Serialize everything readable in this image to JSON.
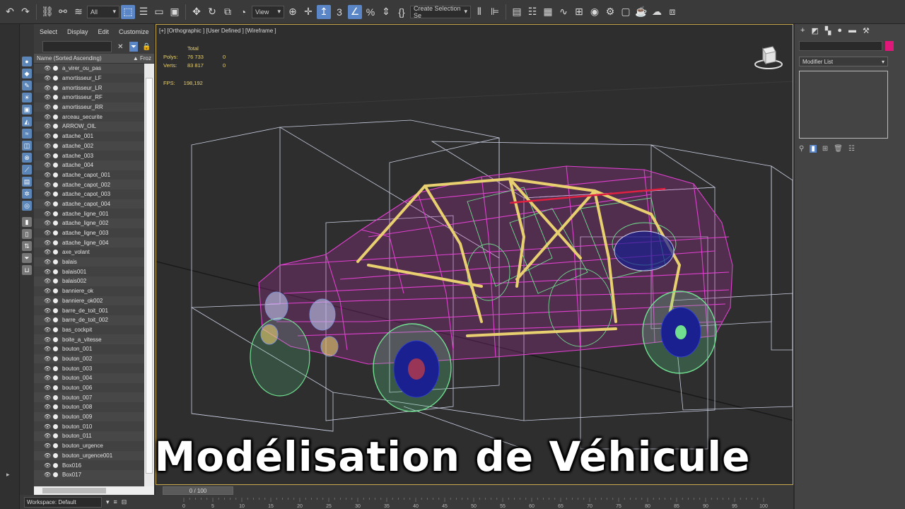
{
  "toolbar": {
    "selection_filter": "All",
    "ref_coord": "View",
    "selection_set_placeholder": "Create Selection Se"
  },
  "explorer": {
    "menu": [
      "Select",
      "Display",
      "Edit",
      "Customize"
    ],
    "column_name": "Name (Sorted Ascending)",
    "column_frozen": "▲ Froz",
    "items": [
      "a_virer_ou_pas",
      "amortisseur_LF",
      "amortisseur_LR",
      "amortisseur_RF",
      "amortisseur_RR",
      "arceau_securite",
      "ARROW_OIL",
      "attache_001",
      "attache_002",
      "attache_003",
      "attache_004",
      "attache_capot_001",
      "attache_capot_002",
      "attache_capot_003",
      "attache_capot_004",
      "attache_ligne_001",
      "attache_ligne_002",
      "attache_ligne_003",
      "attache_ligne_004",
      "axe_volant",
      "balais",
      "balais001",
      "balais002",
      "banniere_ok",
      "banniere_ok002",
      "barre_de_toit_001",
      "barre_de_toit_002",
      "bas_cockpit",
      "boite_a_vitesse",
      "bouton_001",
      "bouton_002",
      "bouton_003",
      "bouton_004",
      "bouton_006",
      "bouton_007",
      "bouton_008",
      "bouton_009",
      "bouton_010",
      "bouton_011",
      "bouton_urgence",
      "bouton_urgence001",
      "Box016",
      "Box017"
    ]
  },
  "workspace": {
    "label": "Workspace: Default"
  },
  "viewport": {
    "label": "[+] [Orthographic ] [User Defined ] [Wireframe ]",
    "stats_header": "Total",
    "polys_label": "Polys:",
    "polys_total": "76 733",
    "polys_sel": "0",
    "verts_label": "Verts:",
    "verts_total": "83 817",
    "verts_sel": "0",
    "fps_label": "FPS:",
    "fps_value": "198,192"
  },
  "timeline": {
    "slider": "0 / 100",
    "ticks": [
      "0",
      "5",
      "10",
      "15",
      "20",
      "25",
      "30",
      "35",
      "40",
      "45",
      "50",
      "55",
      "60",
      "65",
      "70",
      "75",
      "80",
      "85",
      "90",
      "95",
      "100"
    ]
  },
  "command_panel": {
    "modifier_list": "Modifier List"
  },
  "overlay": {
    "title": "Modélisation de Véhicule"
  },
  "colors": {
    "accent": "#5a86c8",
    "viewport_border": "#c8a84c",
    "wire_magenta": "#e040d0",
    "wire_green": "#70e090",
    "wire_yellow": "#e8d070",
    "wire_white": "#d8d8e8",
    "object_color": "#e0187a"
  }
}
